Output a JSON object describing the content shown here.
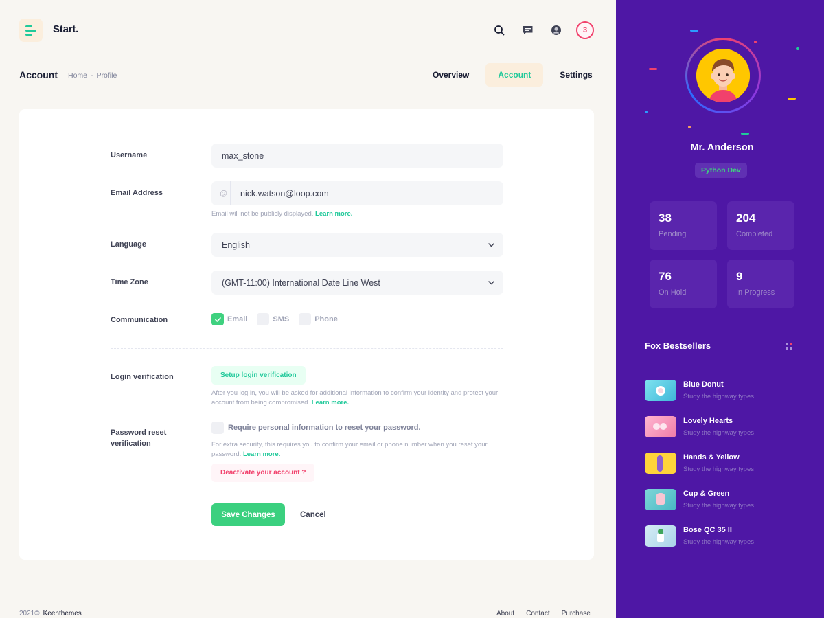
{
  "brand": "Start.",
  "header": {
    "icons": [
      "search-icon",
      "chat-icon",
      "user-icon"
    ],
    "notification_count": "3"
  },
  "page": {
    "title": "Account",
    "breadcrumb": [
      "Home",
      "-",
      "Profile"
    ]
  },
  "tabs": [
    {
      "label": "Overview",
      "active": false
    },
    {
      "label": "Account",
      "active": true
    },
    {
      "label": "Settings",
      "active": false
    }
  ],
  "form": {
    "username": {
      "label": "Username",
      "value": "max_stone"
    },
    "email": {
      "label": "Email Address",
      "prefix": "@",
      "value": "nick.watson@loop.com",
      "help": "Email will not be publicly displayed.",
      "help_link": "Learn more."
    },
    "language": {
      "label": "Language",
      "value": "English"
    },
    "timezone": {
      "label": "Time Zone",
      "value": "(GMT-11:00) International Date Line West"
    },
    "communication": {
      "label": "Communication",
      "options": [
        {
          "label": "Email",
          "checked": true
        },
        {
          "label": "SMS",
          "checked": false
        },
        {
          "label": "Phone",
          "checked": false
        }
      ]
    },
    "login_verification": {
      "label": "Login verification",
      "button": "Setup login verification",
      "help": "After you log in, you will be asked for additional information to confirm your identity and protect your account from being compromised.",
      "help_link": "Learn more."
    },
    "password_reset": {
      "label_line1": "Password reset",
      "label_line2": "verification",
      "checkbox_label": "Require personal information to reset your password.",
      "help": "For extra security, this requires you to confirm your email or phone number when you reset your password.",
      "help_link": "Learn more.",
      "deactivate": "Deactivate your account ?"
    },
    "save_label": "Save Changes",
    "cancel_label": "Cancel"
  },
  "footer": {
    "year": "2021©",
    "company": "Keenthemes",
    "links": [
      "About",
      "Contact",
      "Purchase"
    ]
  },
  "profile": {
    "name": "Mr. Anderson",
    "role": "Python Dev",
    "stats": [
      {
        "value": "38",
        "label": "Pending"
      },
      {
        "value": "204",
        "label": "Completed"
      },
      {
        "value": "76",
        "label": "On Hold"
      },
      {
        "value": "9",
        "label": "In Progress"
      }
    ]
  },
  "bestsellers": {
    "title": "Fox Bestsellers",
    "items": [
      {
        "name": "Blue Donut",
        "sub": "Study the highway types"
      },
      {
        "name": "Lovely Hearts",
        "sub": "Study the highway types"
      },
      {
        "name": "Hands & Yellow",
        "sub": "Study the highway types"
      },
      {
        "name": "Cup & Green",
        "sub": "Study the highway types"
      },
      {
        "name": "Bose QC 35 II",
        "sub": "Study the highway types"
      }
    ]
  },
  "colors": {
    "accent": "#20c99a",
    "sidebar": "#4e17a5",
    "danger": "#f1416c",
    "success_button": "#3bd07f"
  }
}
